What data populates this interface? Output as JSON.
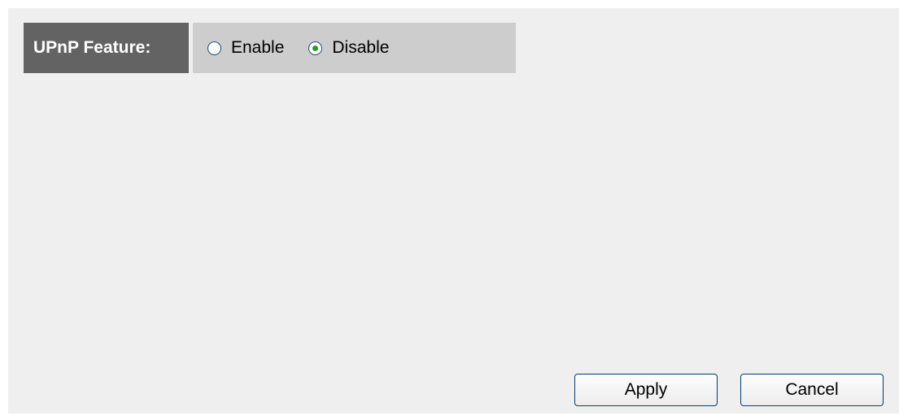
{
  "upnp": {
    "label": "UPnP Feature:",
    "options": [
      {
        "label": "Enable",
        "selected": false
      },
      {
        "label": "Disable",
        "selected": true
      }
    ]
  },
  "buttons": {
    "apply": "Apply",
    "cancel": "Cancel"
  },
  "colors": {
    "label_bg": "#636363",
    "options_bg": "#cdcdcd",
    "panel_bg": "#efefef",
    "radio_selected": "#21a121",
    "button_border": "#003c74"
  }
}
